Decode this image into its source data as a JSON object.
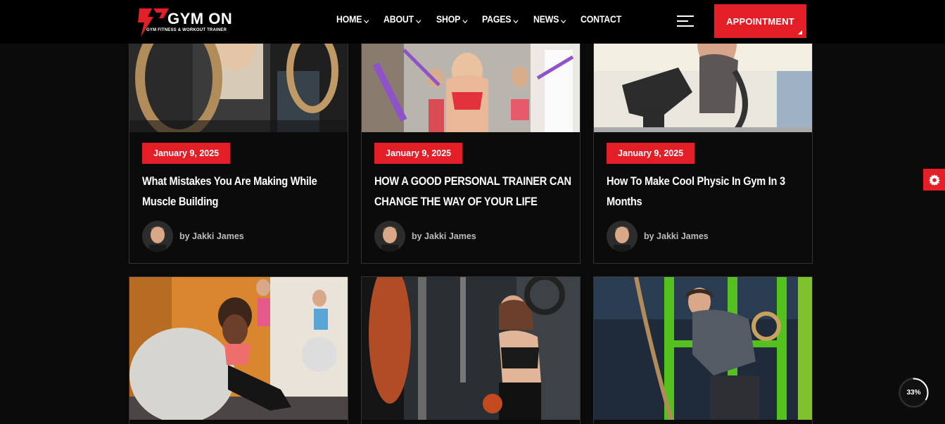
{
  "header": {
    "logo_text": "GYM ON",
    "logo_tagline": "GYM FITNESS & WORKOUT TRAINER",
    "nav": [
      {
        "label": "HOME",
        "has_dropdown": true
      },
      {
        "label": "ABOUT",
        "has_dropdown": true
      },
      {
        "label": "SHOP",
        "has_dropdown": true
      },
      {
        "label": "PAGES",
        "has_dropdown": true
      },
      {
        "label": "NEWS",
        "has_dropdown": true
      },
      {
        "label": "CONTACT",
        "has_dropdown": false
      }
    ],
    "menu_icon": "hamburger-icon",
    "appointment_label": "APPOINTMENT"
  },
  "posts": [
    {
      "date": "January 9, 2025",
      "title_lines": [
        "What Mistakes You Are Making While",
        "Muscle Building"
      ],
      "author": "by Jakki James",
      "image": "gym-rings-photo"
    },
    {
      "date": "January 9, 2025",
      "title_lines": [
        "HOW A GOOD PERSONAL TRAINER CAN",
        "CHANGE THE WAY OF YOUR LIFE"
      ],
      "author": "by Jakki James",
      "image": "resistance-band-class-photo"
    },
    {
      "date": "January 9, 2025",
      "title_lines": [
        "How To Make Cool Physic In Gym In 3",
        "Months"
      ],
      "author": "by Jakki James",
      "image": "elliptical-trainer-photo"
    },
    {
      "image": "fitness-ball-class-photo"
    },
    {
      "image": "cable-machine-workout-photo"
    },
    {
      "image": "ring-training-photo"
    }
  ],
  "settings_icon": "gear-icon",
  "scroll_progress": "33%",
  "colors": {
    "accent": "#e41e26",
    "background": "#0b0b0b",
    "header": "#000000"
  }
}
